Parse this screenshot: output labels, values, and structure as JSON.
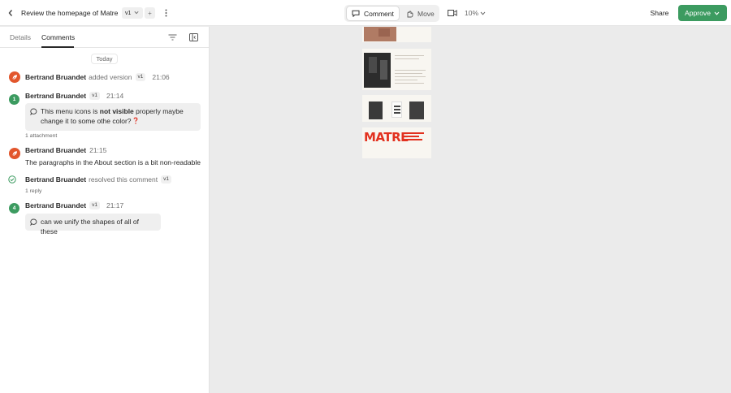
{
  "header": {
    "title": "Review the homepage of Matre",
    "version": "v1",
    "add_label": "+",
    "mode_comment": "Comment",
    "mode_move": "Move",
    "zoom": "10%",
    "share": "Share",
    "approve": "Approve"
  },
  "panel": {
    "tabs": [
      "Details",
      "Comments"
    ],
    "active_tab": "Comments",
    "day_label": "Today",
    "entries": {
      "e1": {
        "author": "Bertrand Bruandet",
        "action": "added version",
        "version": "v1",
        "time": "21:06"
      },
      "e2": {
        "pin": "1",
        "author": "Bertrand Bruandet",
        "version": "v1",
        "time": "21:14",
        "text_a": "This menu icons is ",
        "text_b": "not visible",
        "text_c": " properly maybe",
        "text_d": "change it to some othe color?",
        "footer": "1 attachment"
      },
      "e3": {
        "author": "Bertrand Bruandet",
        "time": "21:15",
        "text": "The paragraphs in the About section is a bit non-readable"
      },
      "e4": {
        "author": "Bertrand Bruandet",
        "action": "resolved this comment",
        "version": "v1",
        "footer": "1 reply"
      },
      "e5": {
        "pin": "4",
        "author": "Bertrand Bruandet",
        "version": "v1",
        "time": "21:17",
        "text": "can we unify the shapes of all of these"
      }
    }
  },
  "canvas": {
    "logo_text": "MATRE"
  },
  "colors": {
    "accent": "#3c9b60",
    "avatar": "#e2562c",
    "brand_red": "#e2311f"
  },
  "icons": [
    "chevron-left-icon",
    "chevron-down-icon",
    "plus-icon",
    "more-icon",
    "comment-icon",
    "move-icon",
    "view-icon",
    "filter-icon",
    "panel-collapse-icon",
    "avatar-logo-icon",
    "check-icon",
    "question-icon"
  ]
}
